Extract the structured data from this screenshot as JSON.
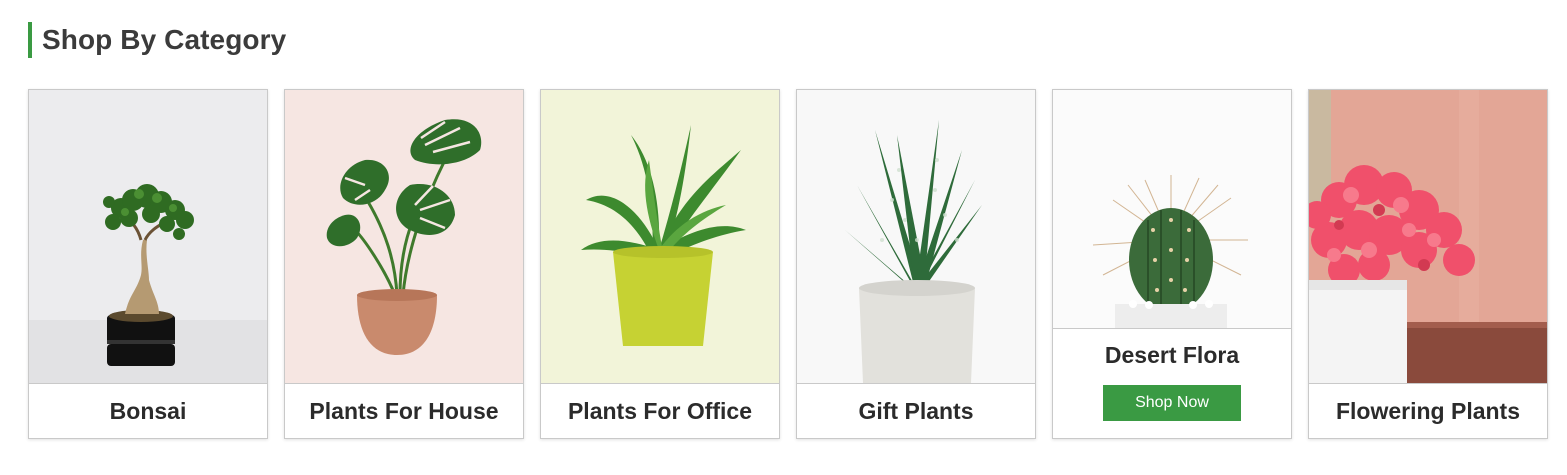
{
  "section": {
    "title": "Shop By Category",
    "accent": "#3a9a43"
  },
  "categories": [
    {
      "label": "Bonsai",
      "image": "bonsai-plant-image",
      "bg": "#ececee"
    },
    {
      "label": "Plants For House",
      "image": "monstera-plant-image",
      "bg": "#f6e6e2"
    },
    {
      "label": "Plants For Office",
      "image": "office-plant-image",
      "bg": "#f2f4d9"
    },
    {
      "label": "Gift Plants",
      "image": "aloe-plant-image",
      "bg": "#f8f8f8"
    },
    {
      "label": "Desert Flora",
      "image": "cactus-plant-image",
      "bg": "#fbfbfb",
      "button": "Shop Now"
    },
    {
      "label": "Flowering Plants",
      "image": "bougainvillea-plant-image",
      "bg": "#e3a696"
    }
  ]
}
